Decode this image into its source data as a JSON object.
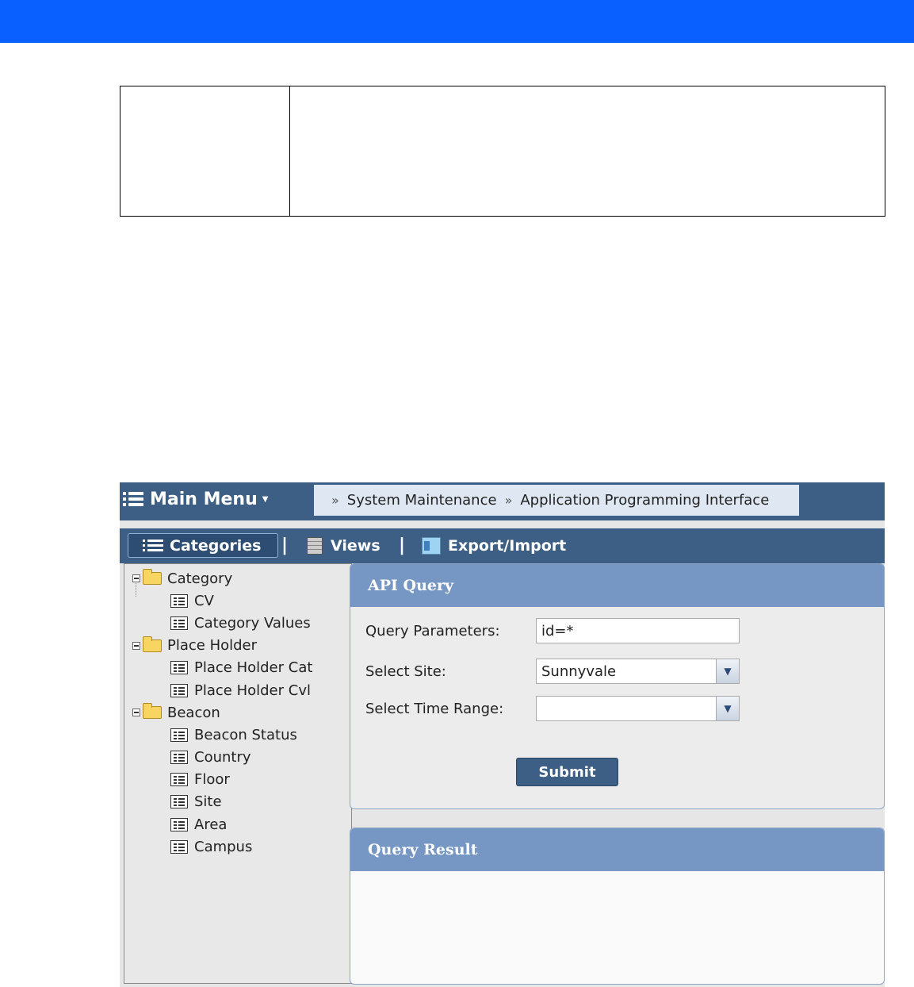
{
  "colors": {
    "banner": "#0a5fff",
    "menubar": "#3e5f85",
    "panel_header": "#7697c3",
    "breadcrumb_bg": "#dfe8f2"
  },
  "app": {
    "main_menu": {
      "label": "Main Menu",
      "icon": "list-menu-icon"
    },
    "breadcrumb": [
      "System Maintenance",
      "Application Programming Interface"
    ],
    "toolbar": {
      "categories": "Categories",
      "views": "Views",
      "export_import": "Export/Import",
      "separator": "|"
    },
    "tree": [
      {
        "label": "Category",
        "children": [
          "CV",
          "Category Values"
        ]
      },
      {
        "label": "Place Holder",
        "children": [
          "Place Holder Cat",
          "Place Holder Cvl"
        ]
      },
      {
        "label": "Beacon",
        "children": [
          "Beacon Status",
          "Country",
          "Floor",
          "Site",
          "Area",
          "Campus"
        ]
      }
    ],
    "api_query": {
      "title": "API Query",
      "query_params_label": "Query Parameters:",
      "query_params_value": "id=*",
      "site_label": "Select Site:",
      "site_value": "Sunnyvale",
      "time_range_label": "Select Time Range:",
      "time_range_value": "",
      "submit": "Submit"
    },
    "query_result": {
      "title": "Query Result"
    }
  }
}
